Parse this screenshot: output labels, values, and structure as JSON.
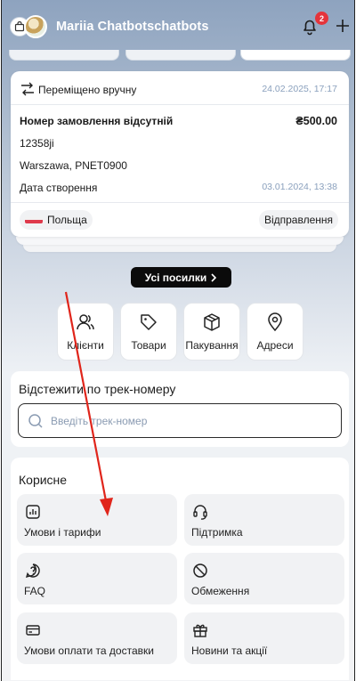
{
  "header": {
    "username": "Mariia Chatbotschatbots",
    "notification_count": "2"
  },
  "shipment_card": {
    "status": "Переміщено вручну",
    "status_date": "24.02.2025, 17:17",
    "order_title": "Номер замовлення відсутній",
    "price": "₴500.00",
    "code": "12358ji",
    "address": "Warszawa, PNET0900",
    "created_label": "Дата створення",
    "created_date": "03.01.2024, 13:38",
    "country": "Польща",
    "shipment_status": "Відправлення"
  },
  "all_parcels_label": "Усі посилки",
  "quick_actions": [
    {
      "label": "Клієнти",
      "icon": "users-icon"
    },
    {
      "label": "Товари",
      "icon": "tag-icon"
    },
    {
      "label": "Пакування",
      "icon": "box-icon"
    },
    {
      "label": "Адреси",
      "icon": "map-pin-icon"
    }
  ],
  "tracking": {
    "title": "Відстежити по трек-номеру",
    "placeholder": "Введіть трек-номер"
  },
  "useful": {
    "title": "Корисне",
    "items": [
      {
        "label": "Умови і тарифи",
        "icon": "chart-icon"
      },
      {
        "label": "Підтримка",
        "icon": "headset-icon"
      },
      {
        "label": "FAQ",
        "icon": "question-icon"
      },
      {
        "label": "Обмеження",
        "icon": "forbidden-icon"
      },
      {
        "label": "Умови оплати та доставки",
        "icon": "credit-card-icon"
      },
      {
        "label": "Новини та акції",
        "icon": "gift-icon"
      }
    ]
  },
  "colors": {
    "accent_date": "#8aa0bd",
    "badge": "#e5343b",
    "annotation_arrow": "#e0251b"
  }
}
